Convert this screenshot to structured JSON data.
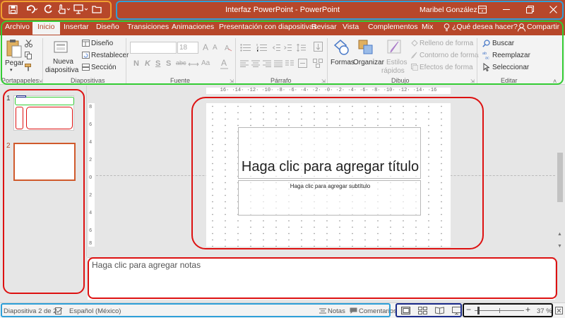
{
  "window": {
    "title": "Interfaz PowerPoint - PowerPoint",
    "user": "Maribel González"
  },
  "colors": {
    "accent": "#b7472a",
    "highlight_orange": "#f0a030",
    "highlight_blue": "#2e9fd8",
    "highlight_green": "#33cc33",
    "highlight_red": "#dd1111",
    "highlight_navy": "#1a2a8a"
  },
  "tabs": [
    "Archivo",
    "Inicio",
    "Insertar",
    "Diseño",
    "Transiciones",
    "Animaciones",
    "Presentación con diapositivas",
    "Revisar",
    "Vista",
    "Complementos",
    "Mix"
  ],
  "tell_me": "¿Qué desea hacer?",
  "share": "Compartir",
  "ribbon": {
    "clipboard": {
      "paste": "Pegar",
      "label": "Portapapeles"
    },
    "slides": {
      "new_slide_1": "Nueva",
      "new_slide_2": "diapositiva",
      "layout": "Diseño",
      "reset": "Restablecer",
      "section": "Sección",
      "label": "Diapositivas"
    },
    "font": {
      "size": "18",
      "bold": "N",
      "italic": "K",
      "underline": "S",
      "strike": "S",
      "spacing": "abc",
      "case": "Aa",
      "grow": "A",
      "shrink": "A",
      "color": "A",
      "label": "Fuente"
    },
    "paragraph": {
      "label": "Párrafo"
    },
    "drawing": {
      "shapes": "Formas",
      "arrange": "Organizar",
      "quick_styles_1": "Estilos",
      "quick_styles_2": "rápidos",
      "fill": "Relleno de forma",
      "outline": "Contorno de forma",
      "effects": "Efectos de forma",
      "label": "Dibujo"
    },
    "editing": {
      "find": "Buscar",
      "replace": "Reemplazar",
      "select": "Seleccionar",
      "label": "Editar"
    }
  },
  "slides": [
    {
      "number": "1"
    },
    {
      "number": "2"
    }
  ],
  "ruler_top": "16· ·14· ·12· ·10· ·8· ·6· ·4· ·2· ·0· ·2· ·4· ·6· ·8· ·10· ·12· ·14· ·16",
  "ruler_left": [
    "8",
    "6",
    "4",
    "2",
    "0",
    "2",
    "4",
    "6",
    "8"
  ],
  "slide": {
    "title_placeholder": "Haga clic para agregar título",
    "subtitle_placeholder": "Haga clic para agregar subtítulo"
  },
  "notes_placeholder": "Haga clic para agregar notas",
  "status": {
    "slide_info": "Diapositiva 2 de 2",
    "language": "Español (México)",
    "notes": "Notas",
    "comments": "Comentarios",
    "zoom": "37 %"
  }
}
